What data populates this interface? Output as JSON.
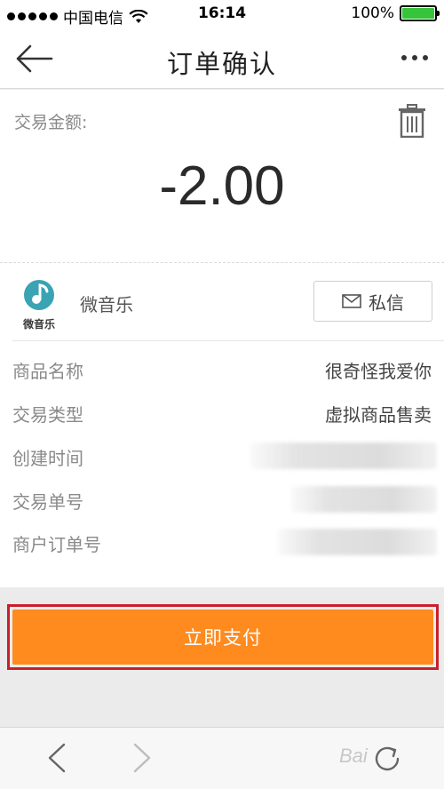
{
  "status_bar": {
    "carrier": "中国电信",
    "time": "16:14",
    "battery": "100%",
    "battery_level": 1.0,
    "signal_icon": "signal-dots-icon",
    "wifi_icon": "wifi-icon",
    "battery_icon": "battery-icon"
  },
  "nav": {
    "title": "订单确认",
    "back_icon": "back-arrow-icon",
    "more_icon": "more-dots-icon"
  },
  "order": {
    "amount_label": "交易金额:",
    "amount": "-2.00",
    "delete_icon": "trash-icon"
  },
  "merchant": {
    "name": "微音乐",
    "logo_text": "微音乐",
    "logo_icon": "music-note-icon",
    "message_button": "私信",
    "message_icon": "envelope-icon"
  },
  "details": [
    {
      "key": "商品名称",
      "value": "很奇怪我爱你"
    },
    {
      "key": "交易类型",
      "value": "虚拟商品售卖"
    },
    {
      "key": "创建时间",
      "value": ""
    },
    {
      "key": "交易单号",
      "value": ""
    },
    {
      "key": "商户订单号",
      "value": ""
    }
  ],
  "pay_button": "立即支付",
  "bottom_bar": {
    "back_icon": "chevron-left-icon",
    "forward_icon": "chevron-right-icon",
    "refresh_icon": "refresh-icon"
  },
  "watermark": "Bai",
  "colors": {
    "accent": "#ff8a1e",
    "highlight_border": "#c8202a",
    "battery_green": "#36c53a",
    "logo_teal": "#3aa3b4"
  }
}
